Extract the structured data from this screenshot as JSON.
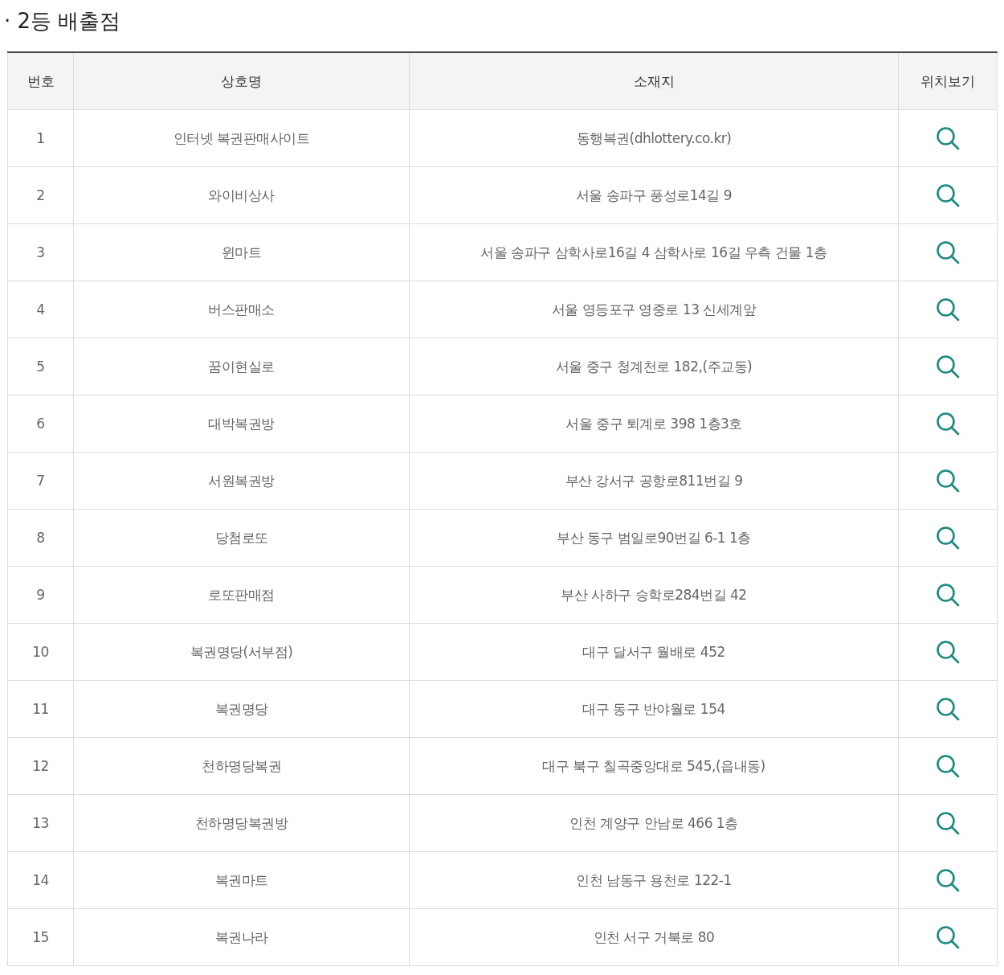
{
  "title": "· 2등 배출점",
  "table": {
    "columns": [
      "번호",
      "상호명",
      "소재지",
      "위치보기"
    ],
    "rows": [
      {
        "number": "1",
        "name": "인터넷 복권판매사이트",
        "address": "동행복권(dhlottery.co.kr)"
      },
      {
        "number": "2",
        "name": "와이비상사",
        "address": "서울 송파구 풍성로14길 9"
      },
      {
        "number": "3",
        "name": "윈마트",
        "address": "서울 송파구 삼학사로16길 4 삼학사로 16길 우측 건물 1층"
      },
      {
        "number": "4",
        "name": "버스판매소",
        "address": "서울 영등포구 영중로 13 신세계앞"
      },
      {
        "number": "5",
        "name": "꿈이현실로",
        "address": "서울 중구 청계천로 182,(주교동)"
      },
      {
        "number": "6",
        "name": "대박복권방",
        "address": "서울 중구 퇴계로 398 1층3호"
      },
      {
        "number": "7",
        "name": "서원복권방",
        "address": "부산 강서구 공항로811번길 9"
      },
      {
        "number": "8",
        "name": "당첨로또",
        "address": "부산 동구 범일로90번길 6-1 1층"
      },
      {
        "number": "9",
        "name": "로또판매점",
        "address": "부산 사하구 승학로284번길 42"
      },
      {
        "number": "10",
        "name": "복권명당(서부점)",
        "address": "대구 달서구 월배로 452"
      },
      {
        "number": "11",
        "name": "복권명당",
        "address": "대구 동구 반야월로 154"
      },
      {
        "number": "12",
        "name": "천하명당복권",
        "address": "대구 북구 칠곡중앙대로 545,(읍내동)"
      },
      {
        "number": "13",
        "name": "천하명당복권방",
        "address": "인천 계양구 안남로 466 1층"
      },
      {
        "number": "14",
        "name": "복권마트",
        "address": "인천 남동구 용천로 122-1"
      },
      {
        "number": "15",
        "name": "복권나라",
        "address": "인천 서구 거북로 80"
      }
    ]
  }
}
